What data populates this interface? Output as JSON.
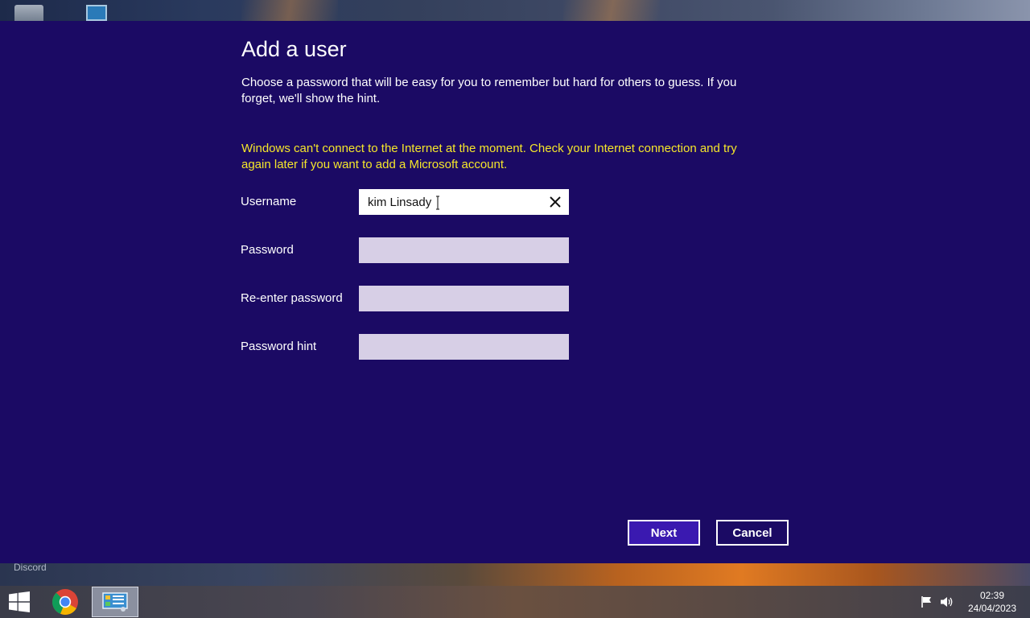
{
  "desktop": {
    "discord_label": "Discord"
  },
  "dialog": {
    "title": "Add a user",
    "description": "Choose a password that will be easy for you to remember but hard for others to guess. If you forget, we'll show the hint.",
    "warning": "Windows can't connect to the Internet at the moment. Check your Internet connection and try again later if you want to add a Microsoft account.",
    "fields": {
      "username": {
        "label": "Username",
        "value": "kim Linsady"
      },
      "password": {
        "label": "Password",
        "value": ""
      },
      "reenter_password": {
        "label": "Re-enter password",
        "value": ""
      },
      "password_hint": {
        "label": "Password hint",
        "value": ""
      }
    },
    "buttons": {
      "next": "Next",
      "cancel": "Cancel"
    },
    "colors": {
      "background": "#1b0a64",
      "warning": "#f5e62a",
      "next_button": "#3a19b0",
      "inactive_input": "#d7cfe6"
    }
  },
  "taskbar": {
    "icons": [
      "windows-start-icon",
      "chrome-icon",
      "control-panel-icon"
    ],
    "tray_icons": [
      "action-center-flag-icon",
      "volume-icon"
    ],
    "time": "02:39",
    "date": "24/04/2023"
  }
}
